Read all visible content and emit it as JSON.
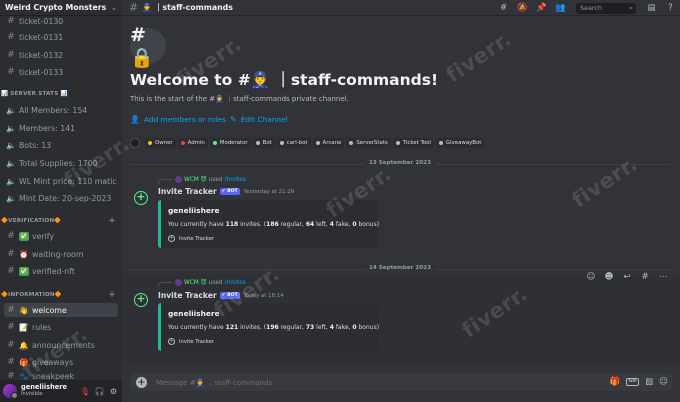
{
  "server": {
    "name": "Weird Crypto Monsters"
  },
  "sidebar": {
    "channels_top": [
      {
        "name": "ticket-0130"
      },
      {
        "name": "ticket-0131"
      },
      {
        "name": "ticket-0132"
      },
      {
        "name": "ticket-0133"
      }
    ],
    "stats_category": "📊 SERVER STATS 📊",
    "stats": [
      {
        "label": "All Members: 154"
      },
      {
        "label": "Members: 141"
      },
      {
        "label": "Bots: 13"
      },
      {
        "label": "Total Supplies: 1700"
      },
      {
        "label": "WL Mint price: 110 matic"
      },
      {
        "label": "Mint Date: 20-sep-2023"
      }
    ],
    "verification_category": "🔶VERIFICATION🔶",
    "verification": [
      {
        "emoji": "✅",
        "name": "verify"
      },
      {
        "emoji": "⏰",
        "name": "waiting-room"
      },
      {
        "emoji": "✅",
        "name": "verified-nft"
      }
    ],
    "information_category": "🔶INFORMATION🔶",
    "information": [
      {
        "emoji": "👋",
        "name": "welcome"
      },
      {
        "emoji": "📝",
        "name": "rules"
      },
      {
        "emoji": "🔔",
        "name": "announcements"
      },
      {
        "emoji": "🎁",
        "name": "giveaways"
      },
      {
        "emoji": "🐾",
        "name": "sneakpeek"
      }
    ],
    "plus": "+"
  },
  "user": {
    "name": "geneliishere",
    "status": "Invisible"
  },
  "topbar": {
    "channel_name": "👮 ｜staff-commands",
    "search_placeholder": "Search"
  },
  "welcome": {
    "badge": "#🔒",
    "title": "Welcome to #👮 ｜staff-commands!",
    "subtitle": "This is the start of the #👮 ｜staff-commands private channel.",
    "add_members": "Add members or roles",
    "edit_channel": "Edit Channel"
  },
  "roles": [
    {
      "name": "Owner",
      "color": "#f1c40f"
    },
    {
      "name": "Admin",
      "color": "#ed4245"
    },
    {
      "name": "Moderator",
      "color": "#57f287"
    },
    {
      "name": "Bot",
      "color": "#b5bac1"
    },
    {
      "name": "carl-bot",
      "color": "#b5bac1"
    },
    {
      "name": "Arcane",
      "color": "#b5bac1"
    },
    {
      "name": "ServerStats",
      "color": "#b5bac1"
    },
    {
      "name": "Ticket Tool",
      "color": "#b5bac1"
    },
    {
      "name": "GiveawayBot",
      "color": "#b5bac1"
    }
  ],
  "messages": [
    {
      "date": "13 September 2023",
      "reply_user": "WCM 😈",
      "reply_used": "used",
      "reply_cmd": "/invites",
      "author": "Invite Tracker",
      "bot_tag": "✔ BOT",
      "timestamp": "Yesterday at 21:29",
      "embed_title": "geneliishere",
      "embed_pre": "You currently have",
      "invites": "118",
      "embed_mid1": "invites. (",
      "regular": "186",
      "embed_mid2": "regular,",
      "left": "64",
      "embed_mid3": "left,",
      "fake": "4",
      "embed_mid4": "fake,",
      "bonus": "0",
      "embed_end": "bonus)",
      "footer": "Invite Tracker"
    },
    {
      "date": "14 September 2023",
      "reply_user": "WCM 😈",
      "reply_used": "used",
      "reply_cmd": "/invites",
      "author": "Invite Tracker",
      "bot_tag": "✔ BOT",
      "timestamp": "Today at 18:14",
      "embed_title": "geneliishere",
      "embed_pre": "You currently have",
      "invites": "121",
      "embed_mid1": "invites. (",
      "regular": "196",
      "embed_mid2": "regular,",
      "left": "73",
      "embed_mid3": "left,",
      "fake": "4",
      "embed_mid4": "fake,",
      "bonus": "0",
      "embed_end": "bonus)",
      "footer": "Invite Tracker"
    }
  ],
  "composer": {
    "placeholder": "Message #👮 ｜staff-commands",
    "gif": "GIF"
  },
  "watermark": "fiverr.",
  "colors": {
    "accent": "#5865f2",
    "link": "#00a8fc",
    "embed_bar": "#1abc9c",
    "online": "#57f287"
  }
}
